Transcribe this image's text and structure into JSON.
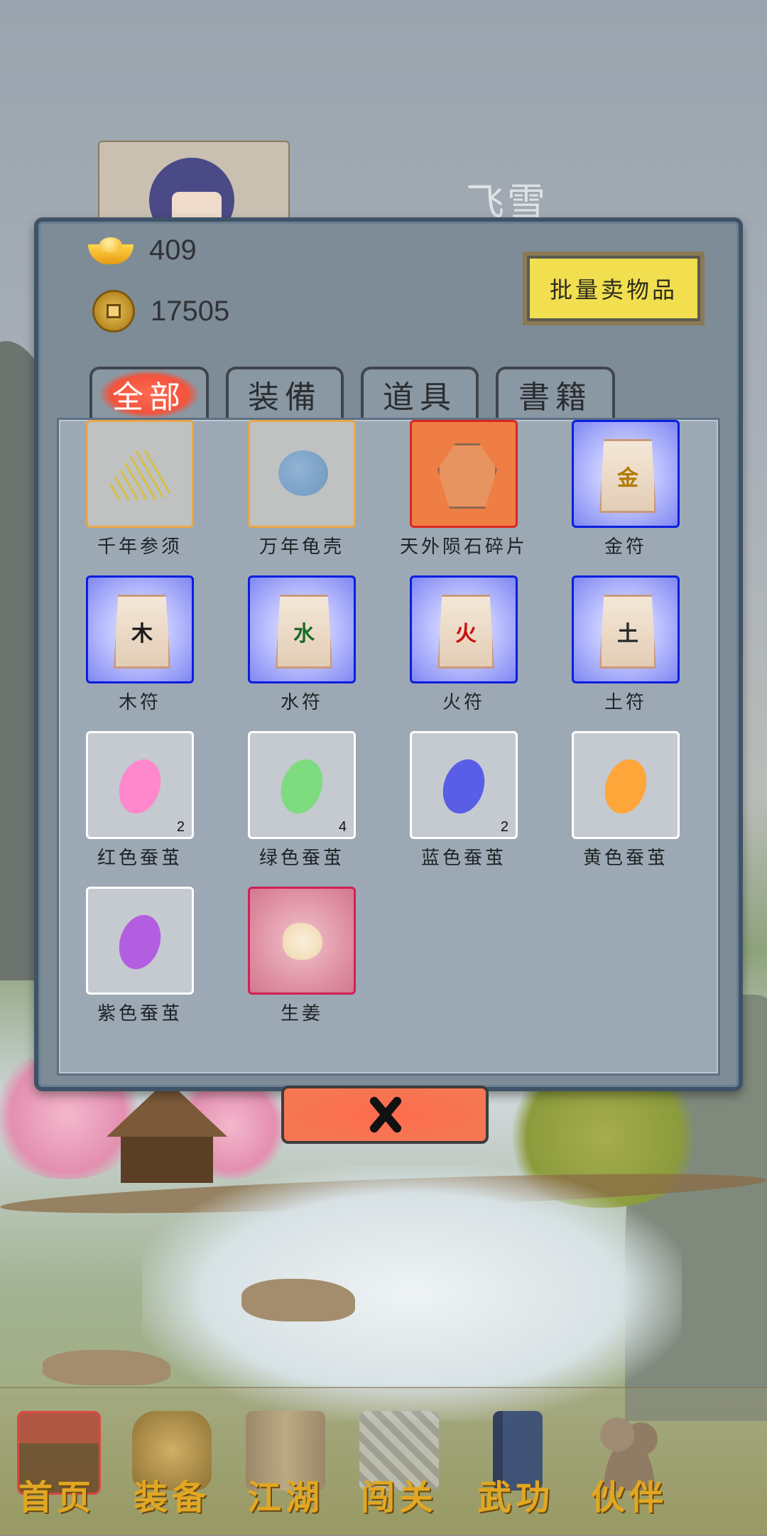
{
  "header": {
    "player_name": "飞雪"
  },
  "currency": {
    "ingots": "409",
    "coins": "17505"
  },
  "actions": {
    "bulk_sell_label": "批量卖物品"
  },
  "tabs": [
    {
      "label": "全部",
      "active": true
    },
    {
      "label": "装備",
      "active": false
    },
    {
      "label": "道具",
      "active": false
    },
    {
      "label": "書籍",
      "active": false
    }
  ],
  "items": [
    {
      "name": "千年参须",
      "rarity": "orange",
      "icon": "ginseng-icon"
    },
    {
      "name": "万年龟壳",
      "rarity": "orange",
      "icon": "turtle-shell-icon"
    },
    {
      "name": "天外陨石碎片",
      "rarity": "red",
      "icon": "meteorite-fragment-icon"
    },
    {
      "name": "金符",
      "rarity": "blue",
      "icon": "talisman-icon",
      "glyph": "金",
      "glyph_color": "#b07a00"
    },
    {
      "name": "木符",
      "rarity": "blue",
      "icon": "talisman-icon",
      "glyph": "木",
      "glyph_color": "#1a1a1a"
    },
    {
      "name": "水符",
      "rarity": "blue",
      "icon": "talisman-icon",
      "glyph": "水",
      "glyph_color": "#1a6b2a"
    },
    {
      "name": "火符",
      "rarity": "blue",
      "icon": "talisman-icon",
      "glyph": "火",
      "glyph_color": "#c81010"
    },
    {
      "name": "土符",
      "rarity": "blue",
      "icon": "talisman-icon",
      "glyph": "土",
      "glyph_color": "#2a2a2a"
    },
    {
      "name": "红色蚕茧",
      "rarity": "white",
      "icon": "cocoon-icon",
      "cocoon_color": "#ff88cc",
      "count": "2"
    },
    {
      "name": "绿色蚕茧",
      "rarity": "white",
      "icon": "cocoon-icon",
      "cocoon_color": "#7fdb7f",
      "count": "4"
    },
    {
      "name": "蓝色蚕茧",
      "rarity": "white",
      "icon": "cocoon-icon",
      "cocoon_color": "#5a5de6",
      "count": "2"
    },
    {
      "name": "黄色蚕茧",
      "rarity": "white",
      "icon": "cocoon-icon",
      "cocoon_color": "#ffa63a"
    },
    {
      "name": "紫色蚕茧",
      "rarity": "white",
      "icon": "cocoon-icon",
      "cocoon_color": "#b35ee0"
    },
    {
      "name": "生姜",
      "rarity": "crimson",
      "icon": "ginger-icon"
    }
  ],
  "bottom_nav": [
    {
      "label": "首页",
      "icon": "house-icon",
      "active": true
    },
    {
      "label": "装备",
      "icon": "armor-icon"
    },
    {
      "label": "江湖",
      "icon": "scroll-icon"
    },
    {
      "label": "闯关",
      "icon": "crossed-swords-icon"
    },
    {
      "label": "武功",
      "icon": "book-icon"
    },
    {
      "label": "伙伴",
      "icon": "partner-icon"
    }
  ]
}
